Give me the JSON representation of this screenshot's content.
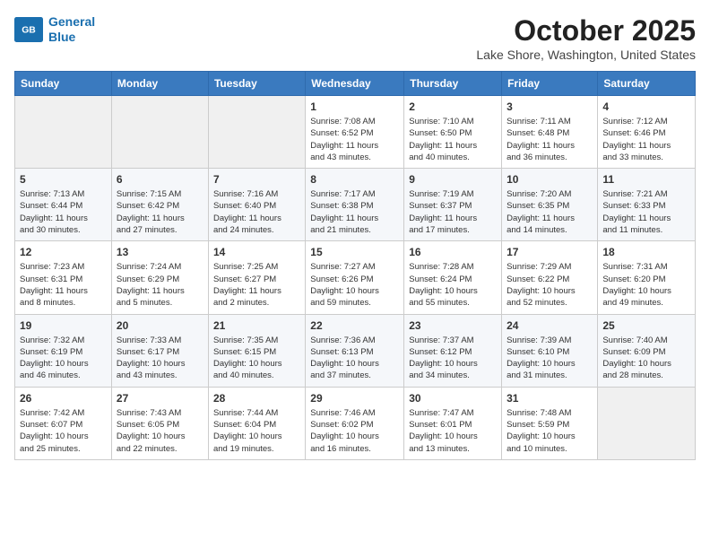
{
  "header": {
    "logo_line1": "General",
    "logo_line2": "Blue",
    "month": "October 2025",
    "location": "Lake Shore, Washington, United States"
  },
  "weekdays": [
    "Sunday",
    "Monday",
    "Tuesday",
    "Wednesday",
    "Thursday",
    "Friday",
    "Saturday"
  ],
  "weeks": [
    [
      {
        "day": "",
        "info": ""
      },
      {
        "day": "",
        "info": ""
      },
      {
        "day": "",
        "info": ""
      },
      {
        "day": "1",
        "info": "Sunrise: 7:08 AM\nSunset: 6:52 PM\nDaylight: 11 hours\nand 43 minutes."
      },
      {
        "day": "2",
        "info": "Sunrise: 7:10 AM\nSunset: 6:50 PM\nDaylight: 11 hours\nand 40 minutes."
      },
      {
        "day": "3",
        "info": "Sunrise: 7:11 AM\nSunset: 6:48 PM\nDaylight: 11 hours\nand 36 minutes."
      },
      {
        "day": "4",
        "info": "Sunrise: 7:12 AM\nSunset: 6:46 PM\nDaylight: 11 hours\nand 33 minutes."
      }
    ],
    [
      {
        "day": "5",
        "info": "Sunrise: 7:13 AM\nSunset: 6:44 PM\nDaylight: 11 hours\nand 30 minutes."
      },
      {
        "day": "6",
        "info": "Sunrise: 7:15 AM\nSunset: 6:42 PM\nDaylight: 11 hours\nand 27 minutes."
      },
      {
        "day": "7",
        "info": "Sunrise: 7:16 AM\nSunset: 6:40 PM\nDaylight: 11 hours\nand 24 minutes."
      },
      {
        "day": "8",
        "info": "Sunrise: 7:17 AM\nSunset: 6:38 PM\nDaylight: 11 hours\nand 21 minutes."
      },
      {
        "day": "9",
        "info": "Sunrise: 7:19 AM\nSunset: 6:37 PM\nDaylight: 11 hours\nand 17 minutes."
      },
      {
        "day": "10",
        "info": "Sunrise: 7:20 AM\nSunset: 6:35 PM\nDaylight: 11 hours\nand 14 minutes."
      },
      {
        "day": "11",
        "info": "Sunrise: 7:21 AM\nSunset: 6:33 PM\nDaylight: 11 hours\nand 11 minutes."
      }
    ],
    [
      {
        "day": "12",
        "info": "Sunrise: 7:23 AM\nSunset: 6:31 PM\nDaylight: 11 hours\nand 8 minutes."
      },
      {
        "day": "13",
        "info": "Sunrise: 7:24 AM\nSunset: 6:29 PM\nDaylight: 11 hours\nand 5 minutes."
      },
      {
        "day": "14",
        "info": "Sunrise: 7:25 AM\nSunset: 6:27 PM\nDaylight: 11 hours\nand 2 minutes."
      },
      {
        "day": "15",
        "info": "Sunrise: 7:27 AM\nSunset: 6:26 PM\nDaylight: 10 hours\nand 59 minutes."
      },
      {
        "day": "16",
        "info": "Sunrise: 7:28 AM\nSunset: 6:24 PM\nDaylight: 10 hours\nand 55 minutes."
      },
      {
        "day": "17",
        "info": "Sunrise: 7:29 AM\nSunset: 6:22 PM\nDaylight: 10 hours\nand 52 minutes."
      },
      {
        "day": "18",
        "info": "Sunrise: 7:31 AM\nSunset: 6:20 PM\nDaylight: 10 hours\nand 49 minutes."
      }
    ],
    [
      {
        "day": "19",
        "info": "Sunrise: 7:32 AM\nSunset: 6:19 PM\nDaylight: 10 hours\nand 46 minutes."
      },
      {
        "day": "20",
        "info": "Sunrise: 7:33 AM\nSunset: 6:17 PM\nDaylight: 10 hours\nand 43 minutes."
      },
      {
        "day": "21",
        "info": "Sunrise: 7:35 AM\nSunset: 6:15 PM\nDaylight: 10 hours\nand 40 minutes."
      },
      {
        "day": "22",
        "info": "Sunrise: 7:36 AM\nSunset: 6:13 PM\nDaylight: 10 hours\nand 37 minutes."
      },
      {
        "day": "23",
        "info": "Sunrise: 7:37 AM\nSunset: 6:12 PM\nDaylight: 10 hours\nand 34 minutes."
      },
      {
        "day": "24",
        "info": "Sunrise: 7:39 AM\nSunset: 6:10 PM\nDaylight: 10 hours\nand 31 minutes."
      },
      {
        "day": "25",
        "info": "Sunrise: 7:40 AM\nSunset: 6:09 PM\nDaylight: 10 hours\nand 28 minutes."
      }
    ],
    [
      {
        "day": "26",
        "info": "Sunrise: 7:42 AM\nSunset: 6:07 PM\nDaylight: 10 hours\nand 25 minutes."
      },
      {
        "day": "27",
        "info": "Sunrise: 7:43 AM\nSunset: 6:05 PM\nDaylight: 10 hours\nand 22 minutes."
      },
      {
        "day": "28",
        "info": "Sunrise: 7:44 AM\nSunset: 6:04 PM\nDaylight: 10 hours\nand 19 minutes."
      },
      {
        "day": "29",
        "info": "Sunrise: 7:46 AM\nSunset: 6:02 PM\nDaylight: 10 hours\nand 16 minutes."
      },
      {
        "day": "30",
        "info": "Sunrise: 7:47 AM\nSunset: 6:01 PM\nDaylight: 10 hours\nand 13 minutes."
      },
      {
        "day": "31",
        "info": "Sunrise: 7:48 AM\nSunset: 5:59 PM\nDaylight: 10 hours\nand 10 minutes."
      },
      {
        "day": "",
        "info": ""
      }
    ]
  ]
}
